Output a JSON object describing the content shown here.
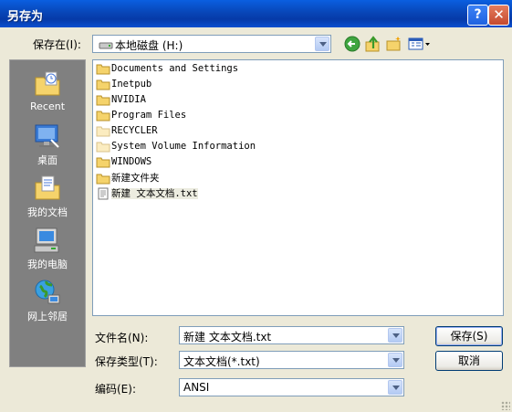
{
  "window": {
    "title": "另存为",
    "help_glyph": "?",
    "close_glyph": "✕"
  },
  "save_in": {
    "label": "保存在(I):",
    "value": "本地磁盘 (H:)"
  },
  "toolbar": {
    "icons": [
      "back-icon",
      "up-folder-icon",
      "new-folder-icon",
      "view-menu-icon"
    ]
  },
  "places": [
    {
      "label": "Recent",
      "icon": "recent-folder-icon"
    },
    {
      "label": "桌面",
      "icon": "desktop-icon"
    },
    {
      "label": "我的文档",
      "icon": "my-documents-icon"
    },
    {
      "label": "我的电脑",
      "icon": "my-computer-icon"
    },
    {
      "label": "网上邻居",
      "icon": "network-icon"
    }
  ],
  "files": [
    {
      "name": "Documents and Settings",
      "type": "folder"
    },
    {
      "name": "Inetpub",
      "type": "folder"
    },
    {
      "name": "NVIDIA",
      "type": "folder"
    },
    {
      "name": "Program Files",
      "type": "folder"
    },
    {
      "name": "RECYCLER",
      "type": "folder-hidden"
    },
    {
      "name": "System Volume Information",
      "type": "folder-hidden"
    },
    {
      "name": "WINDOWS",
      "type": "folder"
    },
    {
      "name": "新建文件夹",
      "type": "folder"
    },
    {
      "name": "新建 文本文档.txt",
      "type": "text",
      "selected": true
    }
  ],
  "filename": {
    "label": "文件名(N):",
    "value": "新建 文本文档.txt"
  },
  "filetype": {
    "label": "保存类型(T):",
    "value": "文本文档(*.txt)"
  },
  "encoding": {
    "label": "编码(E):",
    "value": "ANSI"
  },
  "buttons": {
    "save": "保存(S)",
    "cancel": "取消"
  }
}
